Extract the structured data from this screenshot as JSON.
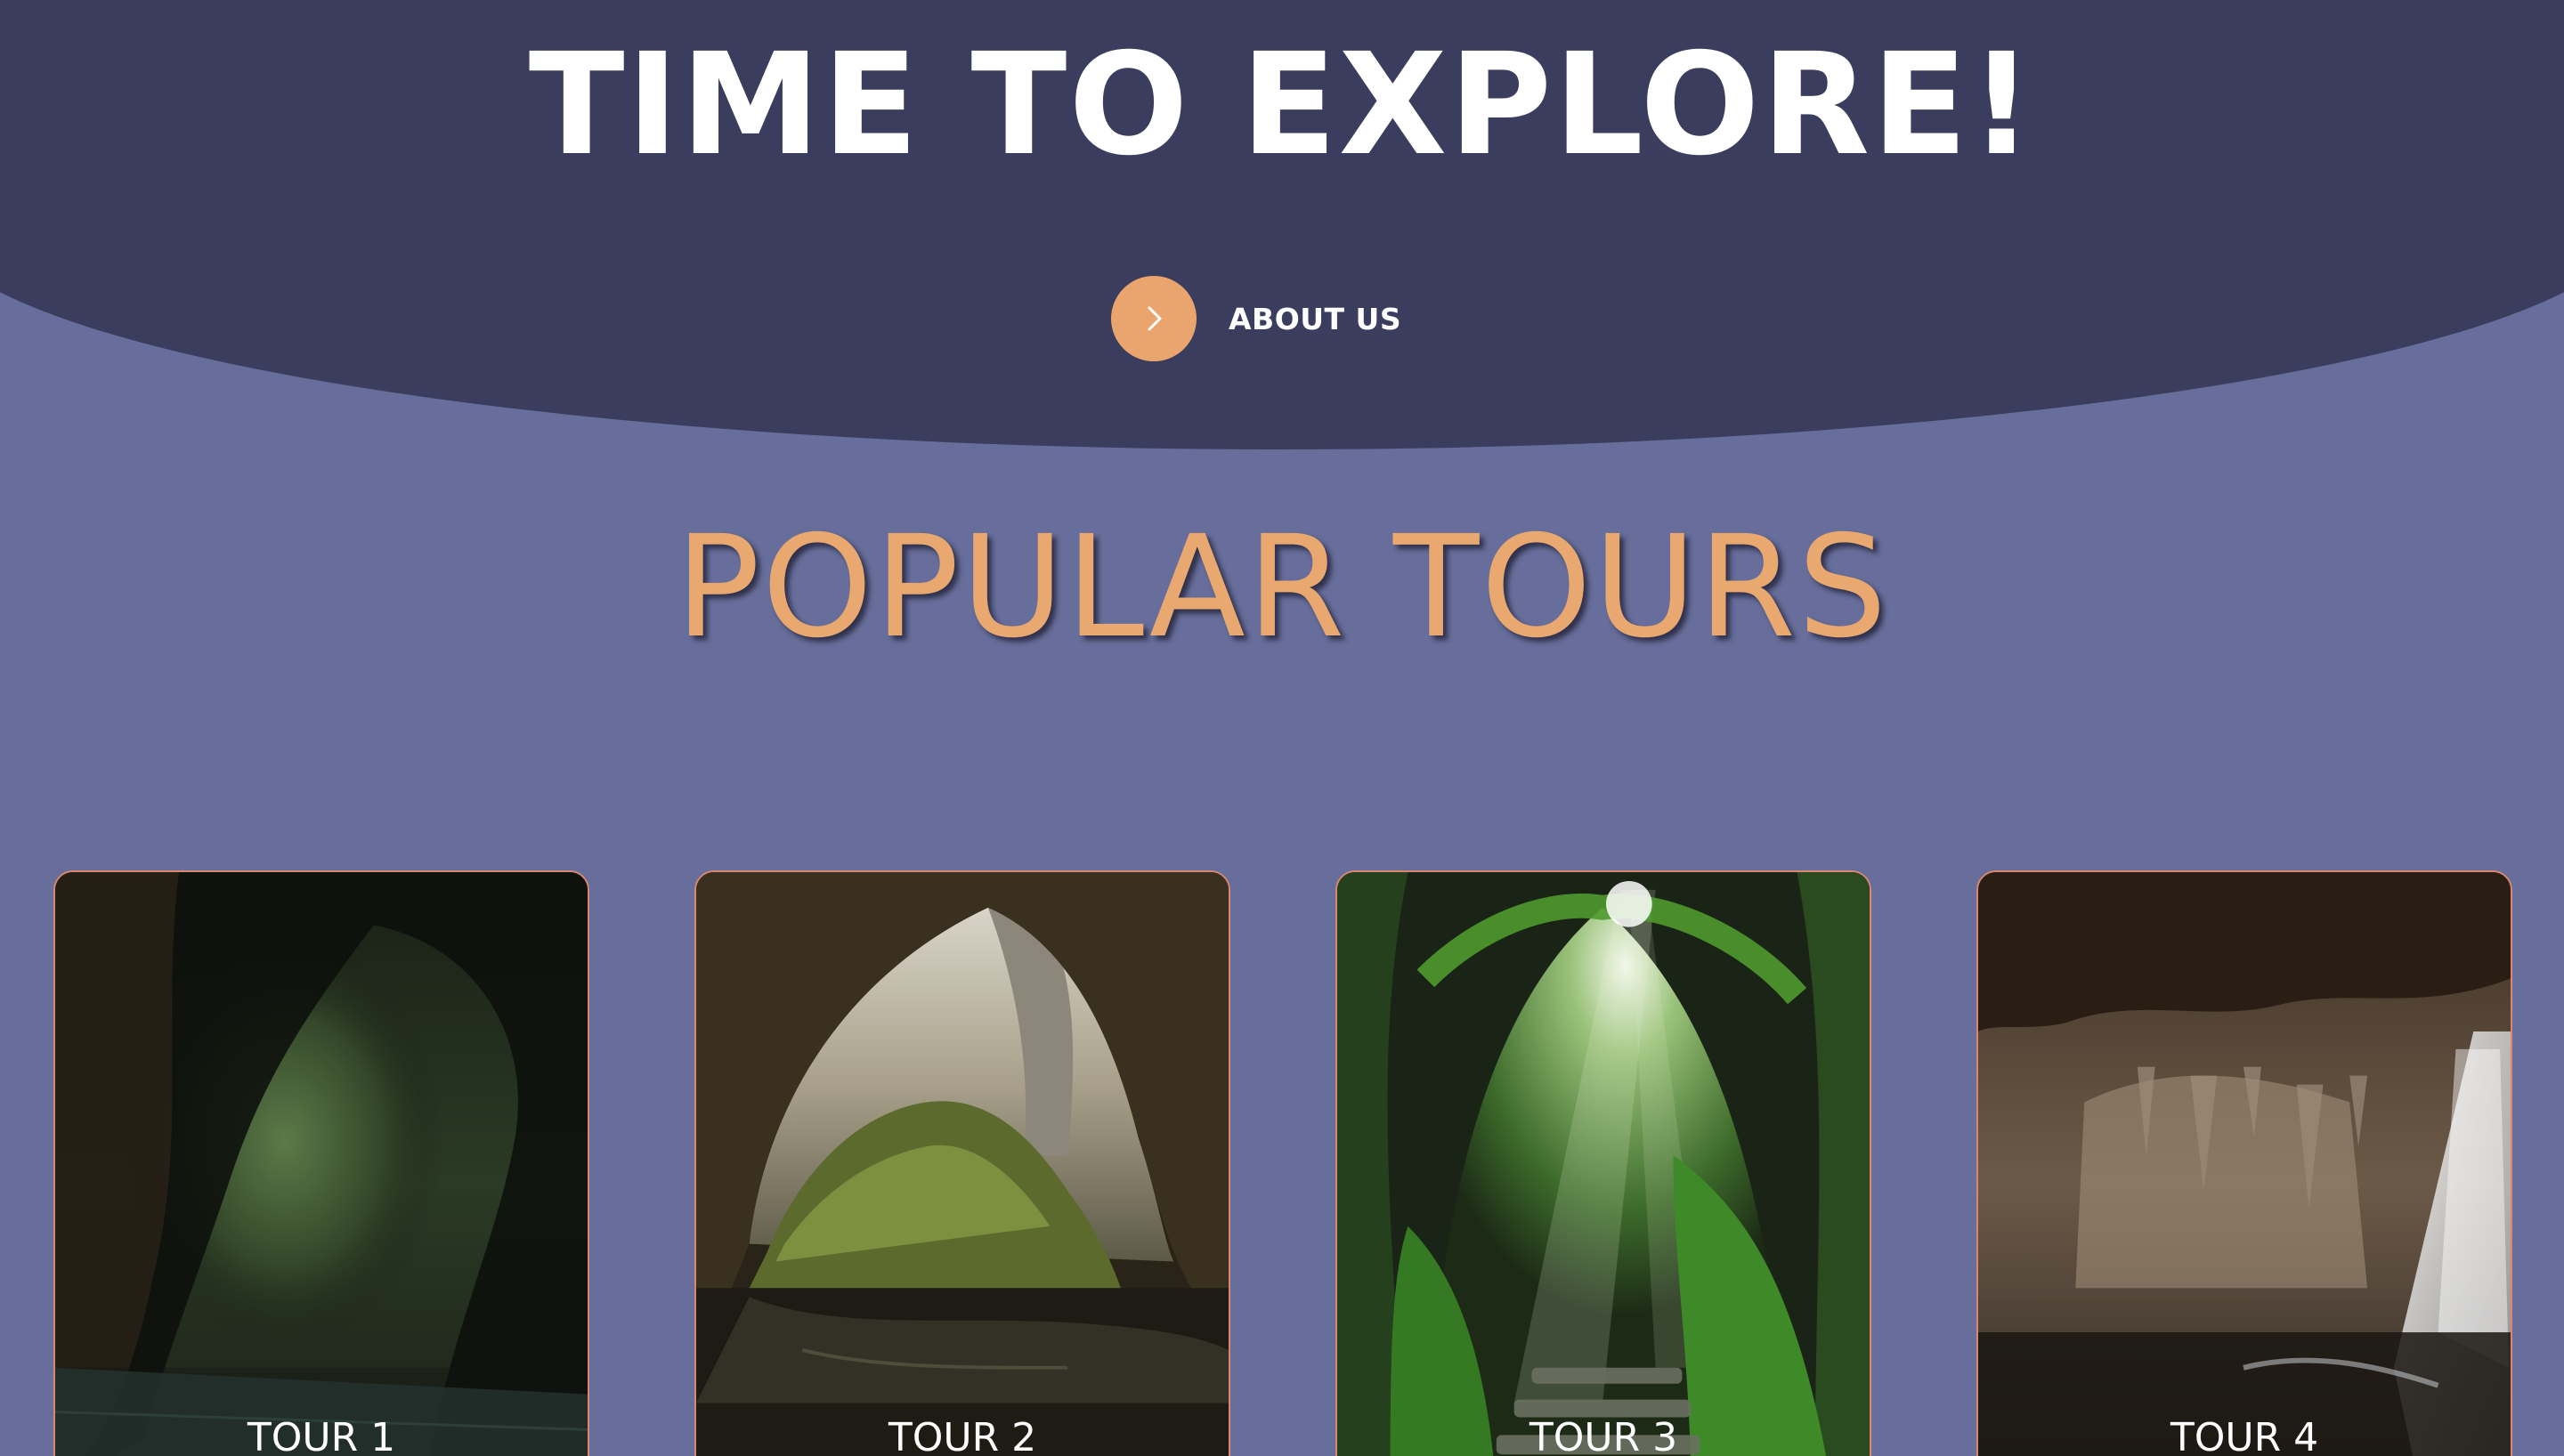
{
  "hero": {
    "title": "TIME TO EXPLORE!",
    "about_label": "ABOUT US",
    "about_icon": "chevron-right-icon"
  },
  "section": {
    "title": "POPULAR TOURS"
  },
  "tours": [
    {
      "label": "TOUR 1"
    },
    {
      "label": "TOUR 2"
    },
    {
      "label": "TOUR 3"
    },
    {
      "label": "TOUR 4"
    }
  ],
  "colors": {
    "hero_bg": "#3a3d5e",
    "page_bg": "#676e9b",
    "accent": "#eaa56e",
    "card_border": "#d9876e"
  }
}
